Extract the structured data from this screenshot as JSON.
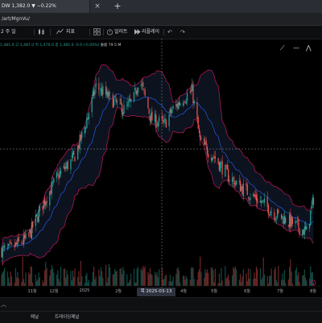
{
  "browser": {
    "tab_title": "DW 1,382.0 ▼ −0.22%",
    "tab_close": "×",
    "tab_new": "+",
    "url": "/art/MgnVu/"
  },
  "toolbar": {
    "interval": "2 주 일",
    "chart_type_icon": "candles-icon",
    "indicators_icon": "fx-icon",
    "indicators_label": "지표",
    "templates_icon": "grid-icon",
    "alert_icon": "alarm-clock-icon",
    "alert_label": "얼러트",
    "replay_icon": "replay-icon",
    "replay_label": "리플레이",
    "undo_icon": "undo-icon",
    "redo_icon": "redo-icon"
  },
  "legend": {
    "ohlc": "1,481.0 고 1,487.0 저 1,476.0 종 1,481.0 -0.0 (-0.00%)",
    "volume": "볼륨 79.5 M"
  },
  "drawing_tools": [
    "trend-line-icon",
    "horizontal-line-icon",
    "pattern-icon"
  ],
  "chart_data": {
    "type": "candlestick",
    "x_axis_labels": [
      "11월",
      "12월",
      "2025",
      "2월",
      "3월",
      "4월",
      "5월",
      "6월",
      "7월",
      "8월"
    ],
    "crosshair_date": "목 2025-03-13",
    "indicators": [
      "bollinger-bands",
      "volume"
    ],
    "colors": {
      "up": "#26a69a",
      "down": "#ef5350",
      "bollinger": "#c2185b",
      "bollinger_basis": "#2962ff",
      "volume_up": "#26a69a",
      "volume_down": "#ef5350"
    },
    "price_path": [
      {
        "date": "2024-10-01",
        "close": 1335
      },
      {
        "date": "2024-10-20",
        "close": 1345
      },
      {
        "date": "2024-11-05",
        "close": 1375
      },
      {
        "date": "2024-11-20",
        "close": 1398
      },
      {
        "date": "2024-12-05",
        "close": 1412
      },
      {
        "date": "2024-12-15",
        "close": 1435
      },
      {
        "date": "2024-12-27",
        "close": 1472
      },
      {
        "date": "2025-01-10",
        "close": 1462
      },
      {
        "date": "2025-01-25",
        "close": 1452
      },
      {
        "date": "2025-02-03",
        "close": 1462
      },
      {
        "date": "2025-02-08",
        "close": 1480
      },
      {
        "date": "2025-02-20",
        "close": 1445
      },
      {
        "date": "2025-03-05",
        "close": 1440
      },
      {
        "date": "2025-03-13",
        "close": 1452
      },
      {
        "date": "2025-03-25",
        "close": 1463
      },
      {
        "date": "2025-04-02",
        "close": 1468
      },
      {
        "date": "2025-04-10",
        "close": 1425
      },
      {
        "date": "2025-04-25",
        "close": 1412
      },
      {
        "date": "2025-05-10",
        "close": 1395
      },
      {
        "date": "2025-05-25",
        "close": 1385
      },
      {
        "date": "2025-06-10",
        "close": 1375
      },
      {
        "date": "2025-06-25",
        "close": 1365
      },
      {
        "date": "2025-07-10",
        "close": 1358
      },
      {
        "date": "2025-07-25",
        "close": 1350
      },
      {
        "date": "2025-08-02",
        "close": 1382
      }
    ]
  },
  "bottom": {
    "panel_icon": "chevron-up-icon",
    "left_label": "패널",
    "right_label": "트레이딩패널"
  }
}
